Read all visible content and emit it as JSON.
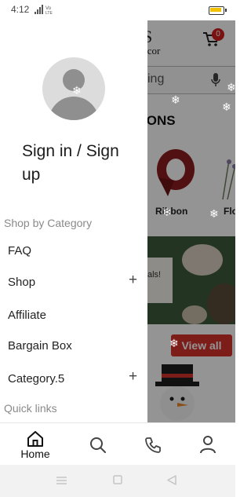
{
  "status_bar": {
    "time": "4:12",
    "network": "Vo LTE"
  },
  "background_app": {
    "logo_line1": "S",
    "logo_line2": "écor",
    "cart_count": "0",
    "search_text": "king",
    "section_title": "IONS",
    "category_1": "Ribbon",
    "category_2": "Flo",
    "banner_text": "als!",
    "view_all_label": "View all"
  },
  "drawer": {
    "sign_in_label": "Sign in / Sign up",
    "shop_by_category_label": "Shop by Category",
    "menu_items": [
      {
        "label": "FAQ",
        "expandable": false
      },
      {
        "label": "Shop",
        "expandable": true
      },
      {
        "label": "Affiliate",
        "expandable": false
      },
      {
        "label": "Bargain Box",
        "expandable": false
      },
      {
        "label": "Category.5",
        "expandable": true
      }
    ],
    "plus_glyph": "+",
    "quick_links_label": "Quick links"
  },
  "bottom_nav": {
    "home_label": "Home",
    "items": [
      "home-icon",
      "search-icon",
      "phone-icon",
      "profile-icon"
    ]
  },
  "colors": {
    "accent_red": "#d7332b",
    "battery_yellow": "#f2c200"
  }
}
